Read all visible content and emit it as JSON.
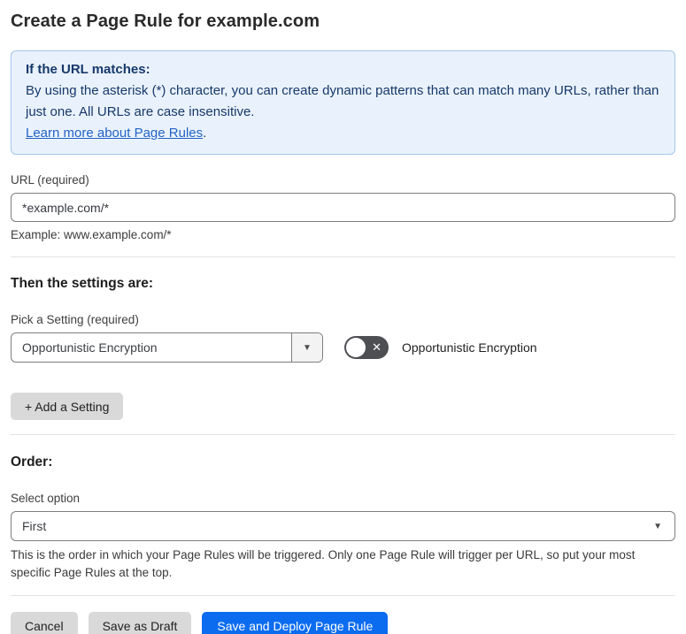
{
  "page": {
    "title": "Create a Page Rule for example.com"
  },
  "colors": {
    "primary_button_blue": "#0b6cf0",
    "info_box_bg": "#e9f2fc",
    "info_box_border": "#a3c6ec",
    "info_text_navy": "#17386a",
    "link_blue": "#2463c5",
    "toggle_off_bg": "#4d4f52",
    "gray_button_bg": "#d9d9d9"
  },
  "info_box": {
    "heading": "If the URL matches:",
    "body": "By using the asterisk (*) character, you can create dynamic patterns that can match many URLs, rather than just one. All URLs are case insensitive.",
    "link_label": "Learn more about Page Rules",
    "link_suffix": "."
  },
  "url_section": {
    "label": "URL (required)",
    "value": "*example.com/*",
    "example": "Example: www.example.com/*"
  },
  "settings_section": {
    "heading": "Then the settings are:",
    "picker_label": "Pick a Setting (required)",
    "selected_setting": "Opportunistic Encryption",
    "dropdown_icon": "▼",
    "toggle": {
      "state": "off",
      "off_icon": "✕",
      "label": "Opportunistic Encryption"
    },
    "add_setting_label": "+ Add a Setting"
  },
  "order_section": {
    "heading": "Order:",
    "label": "Select option",
    "selected_option": "First",
    "dropdown_icon": "▼",
    "help": "This is the order in which your Page Rules will be triggered. Only one Page Rule will trigger per URL, so put your most specific Page Rules at the top."
  },
  "footer": {
    "cancel_label": "Cancel",
    "save_draft_label": "Save as Draft",
    "save_deploy_label": "Save and Deploy Page Rule"
  }
}
